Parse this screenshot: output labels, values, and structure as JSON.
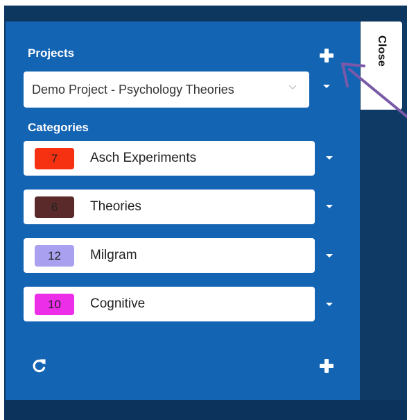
{
  "close_tab": {
    "label": "Close"
  },
  "projects": {
    "heading": "Projects",
    "selected": "Demo Project - Psychology Theories"
  },
  "categories": {
    "heading": "Categories",
    "items": [
      {
        "count": "7",
        "name": "Asch Experiments",
        "color": "#f63111"
      },
      {
        "count": "6",
        "name": "Theories",
        "color": "#5a2a2a"
      },
      {
        "count": "12",
        "name": "Milgram",
        "color": "#a9a0ef"
      },
      {
        "count": "10",
        "name": "Cognitive",
        "color": "#ec2ee9"
      }
    ]
  },
  "colors": {
    "panel": "#1464b4",
    "backdrop": "#0f3a66",
    "annotation_arrow": "#7a5aa8"
  }
}
